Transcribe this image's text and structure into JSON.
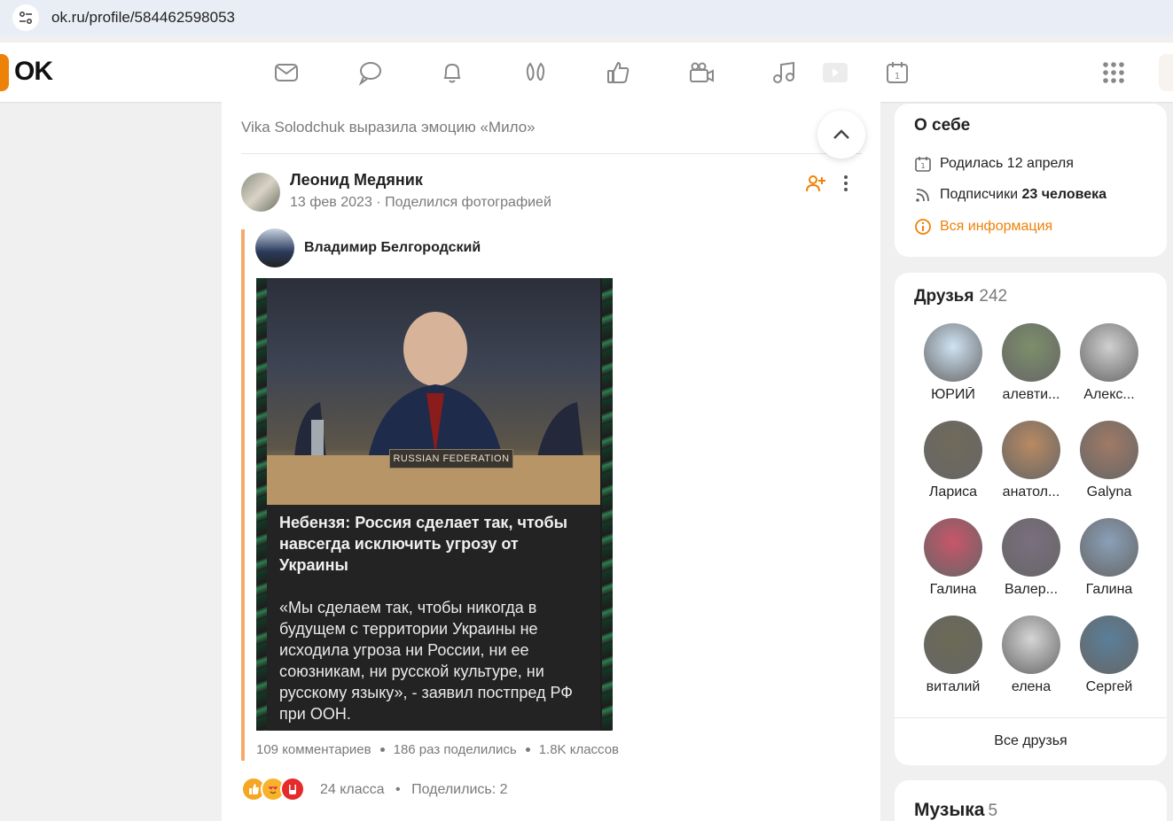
{
  "browser": {
    "url": "ok.ru/profile/584462598053"
  },
  "header": {
    "logo": "OK",
    "nav_icons": [
      "messages-icon",
      "discussions-icon",
      "notifications-icon",
      "guests-icon",
      "likes-icon",
      "video-icon",
      "music-icon",
      "play-icon",
      "events-icon",
      "apps-grid-icon"
    ]
  },
  "feed": {
    "event_text": "Vika Solodchuk выразила эмоцию «Мило»",
    "post": {
      "author": "Леонид Медяник",
      "date": "13 фев 2023",
      "action": "Поделился фотографией",
      "repost": {
        "author": "Владимир Белгородский",
        "card": {
          "nameplate": "RUSSIAN FEDERATION",
          "title": "Небензя: Россия сделает так, чтобы навсегда исключить угрозу от Украины",
          "body": "«Мы сделаем так, чтобы никогда в будущем с территории Украины не исходила угроза ни России, ни ее союзникам, ни русской культуре, ни русскому языку», - заявил постпред РФ при ООН."
        },
        "stats": {
          "comments": "109 комментариев",
          "shares": "186 раз поделились",
          "likes": "1.8K классов"
        }
      },
      "reactions": {
        "likes": "24 класса",
        "shares": "Поделились: 2"
      }
    }
  },
  "about": {
    "title": "О себе",
    "birthday": "Родилась 12 апреля",
    "subscribers_label": "Подписчики",
    "subscribers_value": "23 человека",
    "all_info": "Вся информация"
  },
  "friends": {
    "title": "Друзья",
    "count": "242",
    "items": [
      {
        "name": "ЮРИЙ",
        "color": "#cfe3f3"
      },
      {
        "name": "алевти...",
        "color": "#7d8f6a"
      },
      {
        "name": "Алекс...",
        "color": "#d0d0d0"
      },
      {
        "name": "Лариса",
        "color": "#6f6a5a"
      },
      {
        "name": "анатол...",
        "color": "#b98a62"
      },
      {
        "name": "Galyna",
        "color": "#a07a66"
      },
      {
        "name": "Галина",
        "color": "#c9556a"
      },
      {
        "name": "Валер...",
        "color": "#7a6f7f"
      },
      {
        "name": "Галина",
        "color": "#8aa0b8"
      },
      {
        "name": "виталий",
        "color": "#6c6a55"
      },
      {
        "name": "елена",
        "color": "#d6d6d6"
      },
      {
        "name": "Сергей",
        "color": "#5a7f9a"
      }
    ],
    "all_link": "Все друзья"
  },
  "music": {
    "title": "Музыка",
    "count": "5"
  },
  "colors": {
    "accent": "#ee8208",
    "repost_bar": "#f5a96a"
  }
}
